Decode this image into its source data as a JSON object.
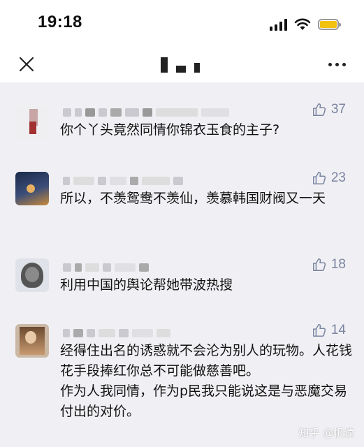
{
  "status_bar": {
    "time": "19:18"
  },
  "nav": {
    "title": ""
  },
  "comments": [
    {
      "likes": "37",
      "text": "你个丫头竟然同情你锦衣玉食的主子?"
    },
    {
      "likes": "23",
      "text": "所以，不羡鸳鸯不羡仙，羡慕韩国财阀又一天"
    },
    {
      "likes": "18",
      "text": "利用中国的舆论帮她带波热搜"
    },
    {
      "likes": "14",
      "text": "经得住出名的诱惑就不会沦为别人的玩物。人花钱花手段捧红你总不可能做慈善吧。\n作为人我同情，作为p民我只能说这是与恶魔交易付出的对价。"
    }
  ],
  "watermark": "知乎 @帆读",
  "colors": {
    "background": "#f0f0f4",
    "like": "#7a84a0",
    "battery": "#f3c211"
  }
}
